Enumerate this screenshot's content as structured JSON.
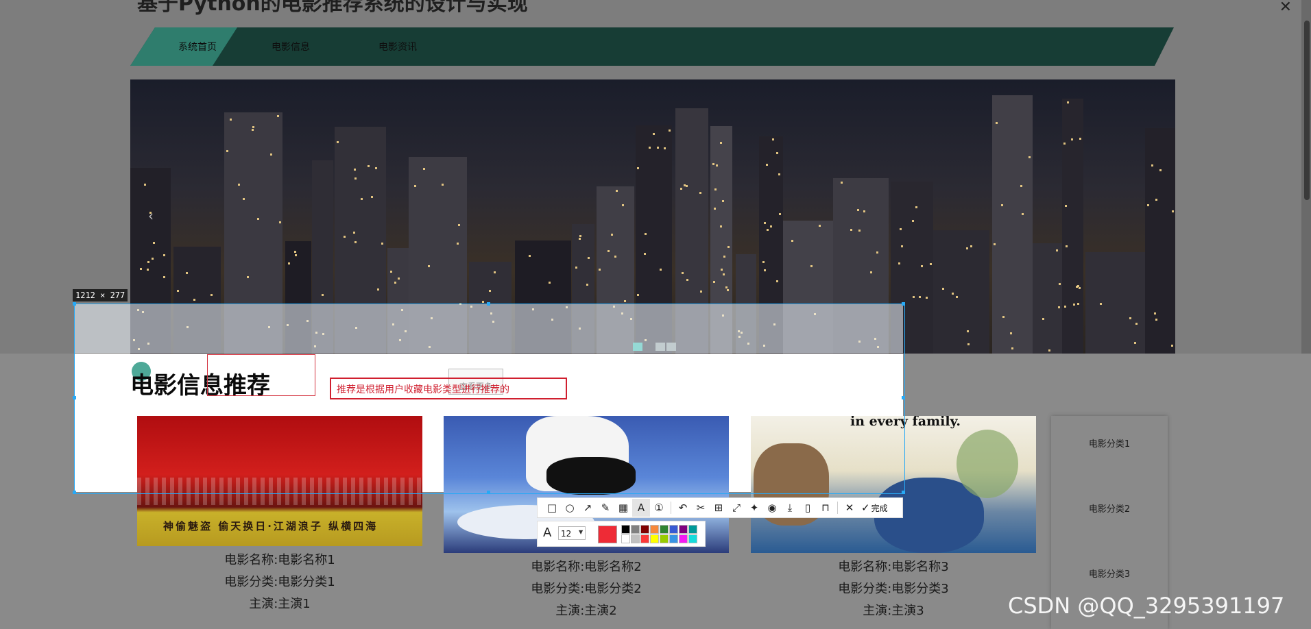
{
  "page": {
    "title": "基于Python的电影推荐系统的设计与实现"
  },
  "nav": {
    "items": [
      "系统首页",
      "电影信息",
      "电影资讯"
    ]
  },
  "selection": {
    "size_label": "1212 × 277"
  },
  "section": {
    "title": "电影信息推荐",
    "annotation_text": "推荐是根据用户收藏电影类型进行推荐的",
    "more_button": "查看更多"
  },
  "posters": {
    "poster3_tagline": "in every family."
  },
  "movies": [
    {
      "name": "电影名称:电影名称1",
      "category": "电影分类:电影分类1",
      "actor": "主演:主演1"
    },
    {
      "name": "电影名称:电影名称2",
      "category": "电影分类:电影分类2",
      "actor": "主演:主演2"
    },
    {
      "name": "电影名称:电影名称3",
      "category": "电影分类:电影分类3",
      "actor": "主演:主演3"
    }
  ],
  "categories": [
    "电影分类1",
    "电影分类2",
    "电影分类3"
  ],
  "toolbar": {
    "done_label": "完成",
    "font_size": "12",
    "current_color": "#ee2b36",
    "palette_top": [
      "#000000",
      "#808080",
      "#800000",
      "#f7883a",
      "#308430",
      "#385ad3",
      "#800080",
      "#009999"
    ],
    "palette_bottom": [
      "#ffffff",
      "#c0c0c0",
      "#fb3838",
      "#ffff00",
      "#99cc00",
      "#3894e4",
      "#f31bf3",
      "#16dcdc"
    ]
  },
  "watermark": "CSDN @QQ_3295391197"
}
